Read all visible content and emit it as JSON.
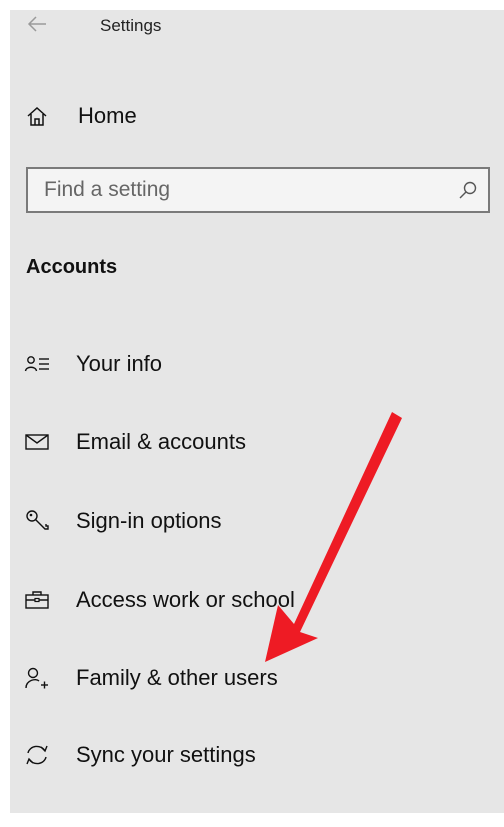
{
  "header": {
    "title": "Settings",
    "back_icon": "back-arrow-icon"
  },
  "home": {
    "label": "Home",
    "icon": "home-icon"
  },
  "search": {
    "placeholder": "Find a setting",
    "value": "",
    "icon": "search-icon"
  },
  "section": {
    "title": "Accounts"
  },
  "nav": {
    "items": [
      {
        "label": "Your info",
        "icon": "person-info-icon"
      },
      {
        "label": "Email & accounts",
        "icon": "envelope-icon"
      },
      {
        "label": "Sign-in options",
        "icon": "key-icon"
      },
      {
        "label": "Access work or school",
        "icon": "briefcase-icon"
      },
      {
        "label": "Family & other users",
        "icon": "add-person-icon"
      },
      {
        "label": "Sync your settings",
        "icon": "sync-icon"
      }
    ]
  },
  "annotation": {
    "arrow_color": "#ee1b24",
    "icon": "red-arrow-annotation"
  }
}
